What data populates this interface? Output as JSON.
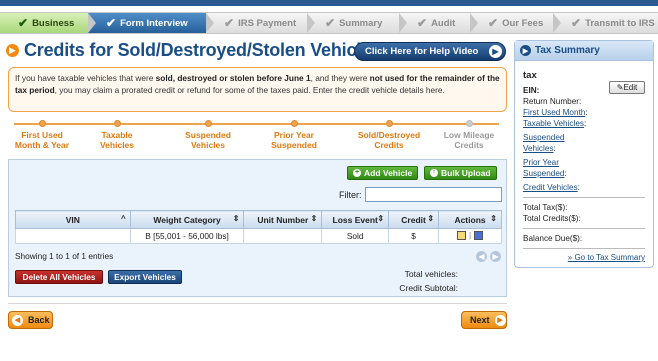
{
  "steps": [
    {
      "label": "Business",
      "state": "done"
    },
    {
      "label": "Form Interview",
      "state": "active"
    },
    {
      "label": "IRS Payment",
      "state": "todo"
    },
    {
      "label": "Summary",
      "state": "todo"
    },
    {
      "label": "Audit",
      "state": "todo"
    },
    {
      "label": "Our Fees",
      "state": "todo"
    },
    {
      "label": "Transmit to IRS",
      "state": "todo"
    }
  ],
  "page": {
    "title": "Credits for Sold/Destroyed/Stolen Vehicles",
    "help_button": "Click Here for Help Video"
  },
  "info": {
    "p1": "If you have taxable vehicles that were ",
    "b1": "sold, destroyed or stolen before June 1",
    "p2": ", and they were ",
    "b2": "not used for the remainder of the tax period",
    "p3": ", you may claim a prorated credit or refund for some of the taxes paid. Enter the credit vehicle details here."
  },
  "sub_steps": [
    {
      "line1": "First Used",
      "line2": "Month & Year",
      "state": "active"
    },
    {
      "line1": "Taxable",
      "line2": "Vehicles",
      "state": "active"
    },
    {
      "line1": "Suspended",
      "line2": "Vehicles",
      "state": "active"
    },
    {
      "line1": "Prior Year",
      "line2": "Suspended",
      "state": "active"
    },
    {
      "line1": "Sold/Destroyed",
      "line2": "Credits",
      "state": "active"
    },
    {
      "line1": "Low Mileage",
      "line2": "Credits",
      "state": "disabled"
    }
  ],
  "grid": {
    "add_vehicle": "Add Vehicle",
    "bulk_upload": "Bulk Upload",
    "filter_label": "Filter:",
    "filter_value": "",
    "columns": [
      "VIN",
      "Weight Category",
      "Unit Number",
      "Loss Event",
      "Credit",
      "Actions"
    ],
    "rows": [
      {
        "vin": "",
        "weight": "B [55,001 - 56,000 lbs]",
        "unit": "",
        "loss": "Sold",
        "credit": "$"
      }
    ],
    "showing": "Showing 1 to 1 of 1 entries",
    "delete_all": "Delete All Vehicles",
    "export": "Export Vehicles",
    "total_vehicles": "Total vehicles:",
    "credit_subtotal": "Credit Subtotal:"
  },
  "nav": {
    "back": "Back",
    "next": "Next"
  },
  "tax_summary": {
    "title": "Tax Summary",
    "name": "tax",
    "edit": "Edit",
    "ein": "EIN:",
    "return_number": "Return Number:",
    "first_used_month": "First Used Month",
    "taxable_vehicles": "Taxable Vehicles",
    "suspended_vehicles": "Suspended Vehicles",
    "prior_year_suspended": "Prior Year Suspended",
    "credit_vehicles": "Credit Vehicles",
    "total_tax": "Total Tax($):",
    "total_credits": "Total Credits($):",
    "balance_due": "Balance Due($):",
    "goto": "» Go to Tax Summary"
  }
}
